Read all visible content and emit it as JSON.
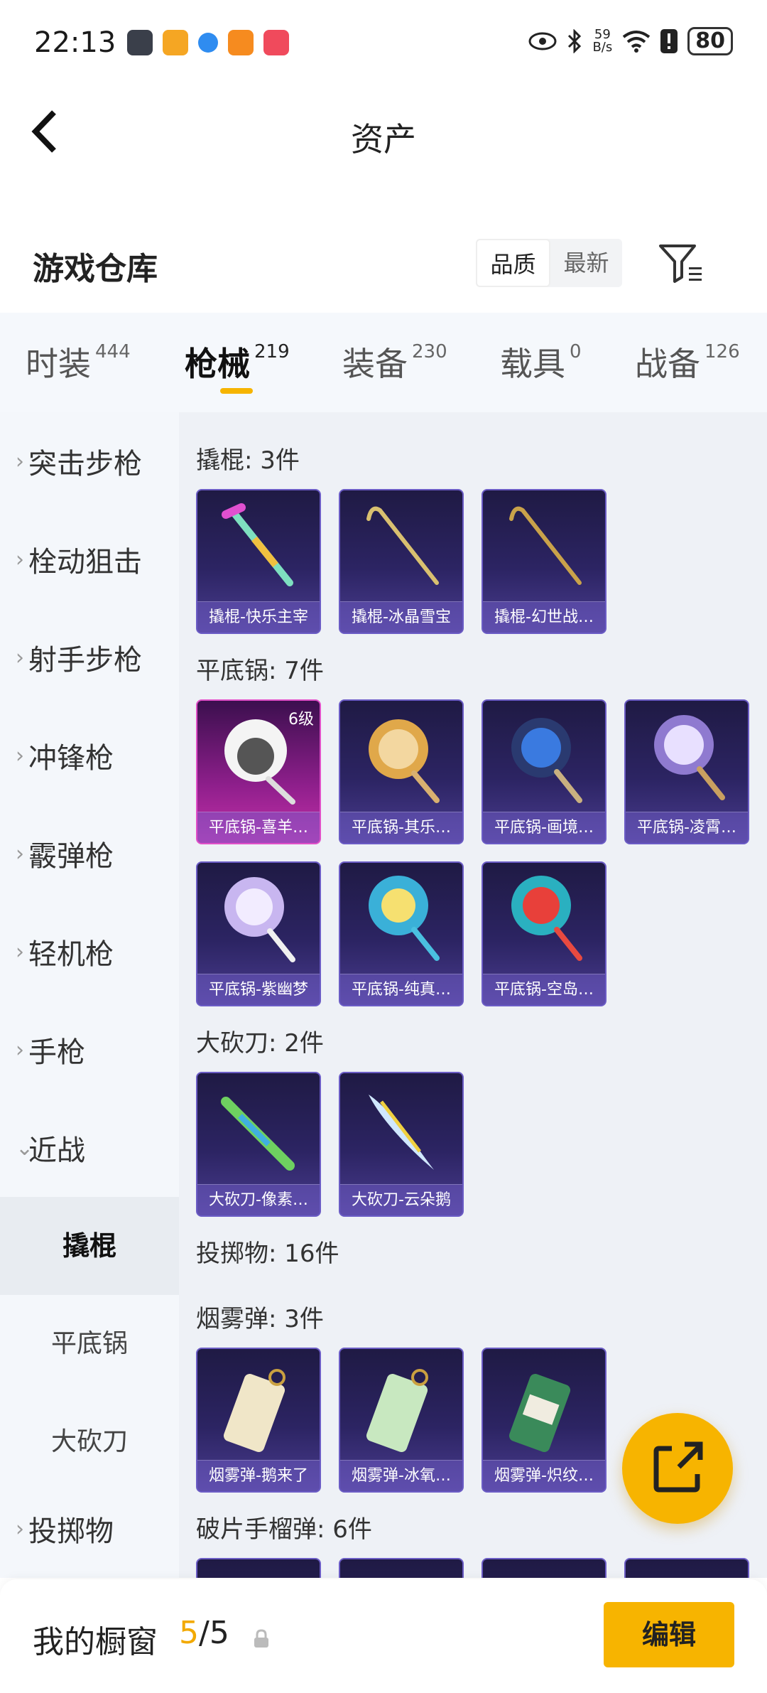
{
  "status_bar": {
    "time": "22:13",
    "net_speed_value": "59",
    "net_speed_unit": "B/s",
    "battery": "80"
  },
  "header": {
    "title": "资产"
  },
  "section": {
    "title": "游戏仓库",
    "sort_quality": "品质",
    "sort_newest": "最新"
  },
  "tabs": [
    {
      "label": "时装",
      "count": "444"
    },
    {
      "label": "枪械",
      "count": "219"
    },
    {
      "label": "装备",
      "count": "230"
    },
    {
      "label": "载具",
      "count": "0"
    },
    {
      "label": "战备",
      "count": "126"
    }
  ],
  "sidebar": {
    "items": [
      {
        "label": "突击步枪",
        "chevron": "›"
      },
      {
        "label": "栓动狙击",
        "chevron": "›"
      },
      {
        "label": "射手步枪",
        "chevron": "›"
      },
      {
        "label": "冲锋枪",
        "chevron": "›"
      },
      {
        "label": "霰弹枪",
        "chevron": "›"
      },
      {
        "label": "轻机枪",
        "chevron": "›"
      },
      {
        "label": "手枪",
        "chevron": "›"
      },
      {
        "label": "近战",
        "chevron": "⌄"
      },
      {
        "label": "投掷物",
        "chevron": "›"
      }
    ],
    "sub_items": [
      "撬棍",
      "平底锅",
      "大砍刀"
    ]
  },
  "groups": {
    "crowbar": {
      "title": "撬棍: 3件",
      "items": [
        "撬棍-快乐主宰",
        "撬棍-冰晶雪宝",
        "撬棍-幻世战…"
      ]
    },
    "pan": {
      "title": "平底锅: 7件",
      "items": [
        "平底锅-喜羊…",
        "平底锅-其乐…",
        "平底锅-画境…",
        "平底锅-凌霄…",
        "平底锅-紫幽梦",
        "平底锅-纯真…",
        "平底锅-空岛…"
      ],
      "first_level": "6级"
    },
    "machete": {
      "title": "大砍刀: 2件",
      "items": [
        "大砍刀-像素…",
        "大砍刀-云朵鹅"
      ]
    },
    "throwable": {
      "title": "投掷物: 16件"
    },
    "smoke": {
      "title": "烟雾弹: 3件",
      "items": [
        "烟雾弹-鹅来了",
        "烟雾弹-冰氧…",
        "烟雾弹-炽纹…"
      ]
    },
    "frag": {
      "title": "破片手榴弹: 6件"
    }
  },
  "bottom_bar": {
    "label": "我的橱窗",
    "current": "5",
    "separator": "/",
    "total": "5",
    "edit": "编辑"
  },
  "colors": {
    "accent": "#f7b400",
    "card_bg": "#2c2463",
    "card_rare": "#8f1f8c"
  }
}
